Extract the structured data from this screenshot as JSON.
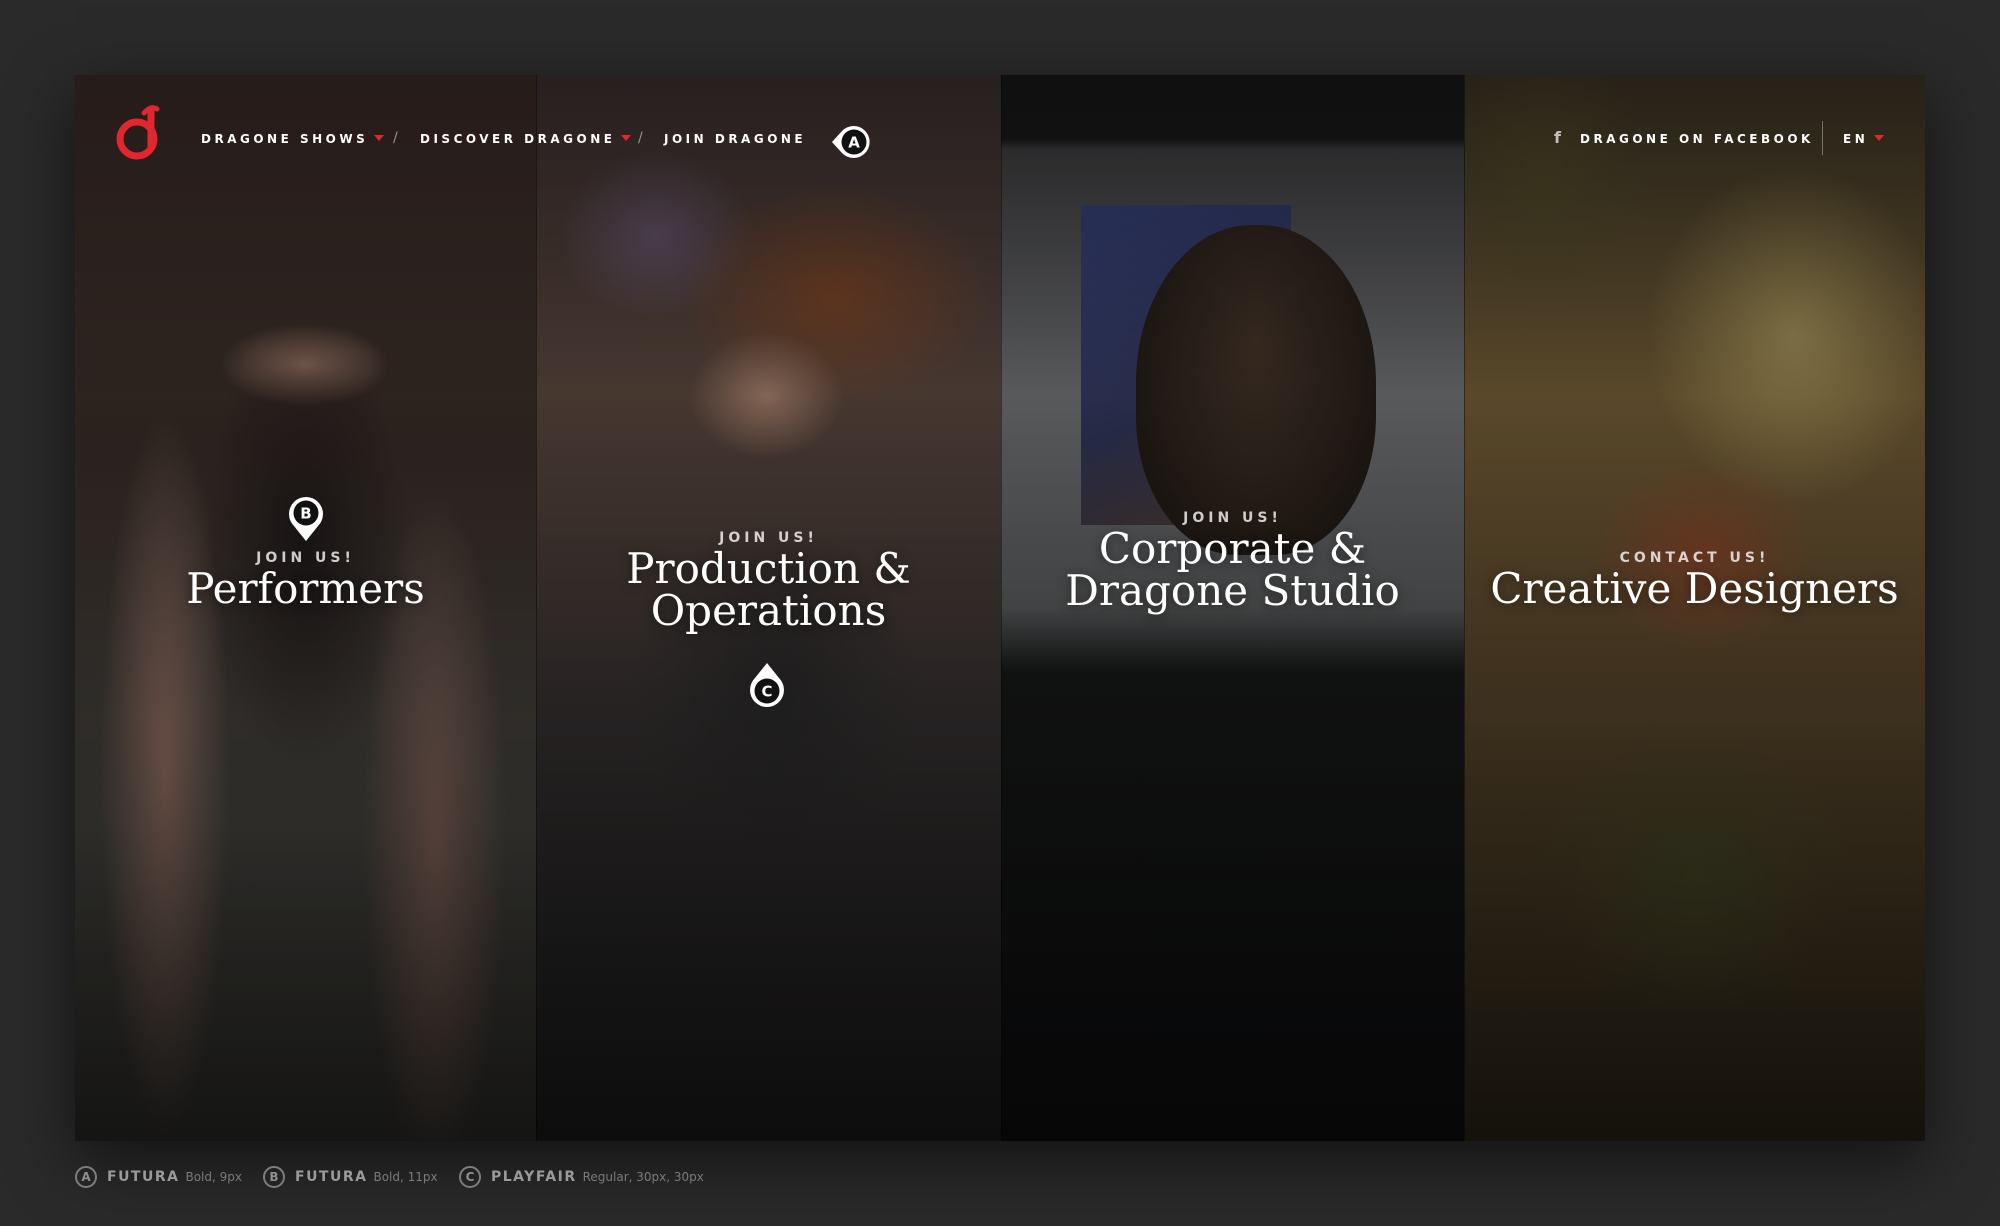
{
  "nav": {
    "items": [
      {
        "label": "DRAGONE SHOWS",
        "has_dropdown": true
      },
      {
        "label": "DISCOVER DRAGONE",
        "has_dropdown": true
      },
      {
        "label": "JOIN DRAGONE",
        "has_dropdown": false
      }
    ],
    "separator": "/",
    "facebook_icon": "f",
    "facebook_label": "DRAGONE ON FACEBOOK",
    "language": "EN",
    "accent_color": "#e0262e"
  },
  "panels": [
    {
      "kicker": "JOIN US!",
      "title": "Performers"
    },
    {
      "kicker": "JOIN US!",
      "title_line1": "Production &",
      "title_line2": "Operations"
    },
    {
      "kicker": "JOIN US!",
      "title_line1": "Corporate &",
      "title_line2": "Dragone Studio"
    },
    {
      "kicker": "CONTACT US!",
      "title": "Creative Designers"
    }
  ],
  "markers": {
    "a": "A",
    "b": "B",
    "c": "C"
  },
  "legend": [
    {
      "letter": "A",
      "font": "FUTURA",
      "spec": "Bold, 9px"
    },
    {
      "letter": "B",
      "font": "FUTURA",
      "spec": "Bold, 11px"
    },
    {
      "letter": "C",
      "font": "PLAYFAIR",
      "spec": "Regular, 30px, 30px"
    }
  ]
}
